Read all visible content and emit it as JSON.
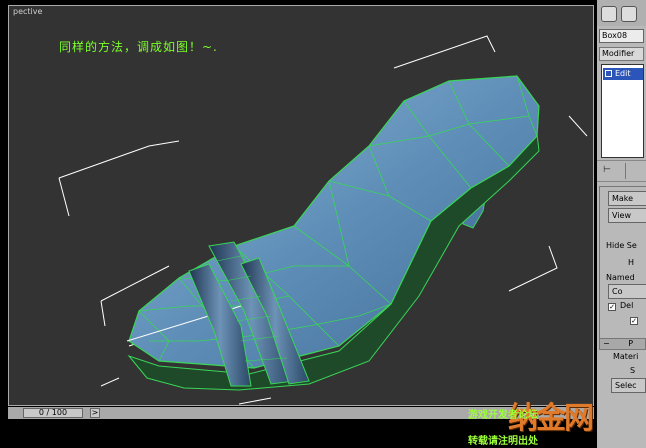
{
  "viewport": {
    "label": "pective",
    "annotation": "同样的方法，调成如图！~."
  },
  "command_panel": {
    "object_name": "Box08",
    "modifier_list": "Modifier",
    "stack_item": "Edit",
    "buttons": [
      "Make",
      "View"
    ],
    "hide_label": "Hide Se",
    "h_label": "H",
    "named_label": "Named",
    "co_label": "Co",
    "del_label": "Del",
    "rollout_label": "P",
    "material_label": "Materi",
    "s_label": "S",
    "select_label": "Selec"
  },
  "timebar": {
    "frame_readout": "0 / 100",
    "next_label": ">"
  },
  "watermark": {
    "logo": "纳金网",
    "line1": "游戏开发者论坛",
    "line2": "转载请注明出处"
  },
  "colors": {
    "viewport_bg": "#333333",
    "model_fill": "#5f8fb8",
    "wire": "#39d657",
    "annotation": "#7dff2a"
  }
}
